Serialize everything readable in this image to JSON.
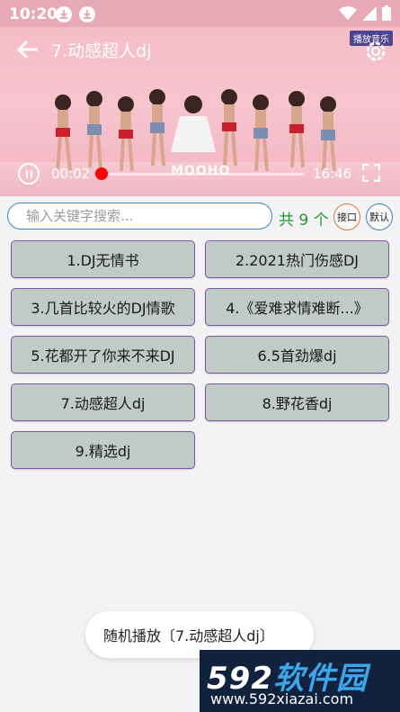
{
  "status": {
    "time": "10:20"
  },
  "player": {
    "title": "7.动感超人dj",
    "badge": "播放音乐",
    "current_time": "00:02",
    "total_time": "16:46",
    "progress": 0.002,
    "watermark": "MOOHO"
  },
  "search": {
    "placeholder": "输入关键字搜索..."
  },
  "count_text": "共 9 个",
  "buttons": {
    "api": "接口",
    "default": "默认"
  },
  "songs": [
    "1.DJ无情书",
    "2.2021热门伤感DJ",
    "3.几首比较火的DJ情歌",
    "4.《爱难求情难断...》",
    "5.花都开了你来不来DJ",
    "6.5首劲爆dj",
    "7.动感超人dj",
    "8.野花香dj",
    "9.精选dj"
  ],
  "toast": "随机播放〔7.动感超人dj〕",
  "site_logo": {
    "main_prefix": "592",
    "main_suffix": "软件园",
    "url": "www.592xiazai.com"
  }
}
